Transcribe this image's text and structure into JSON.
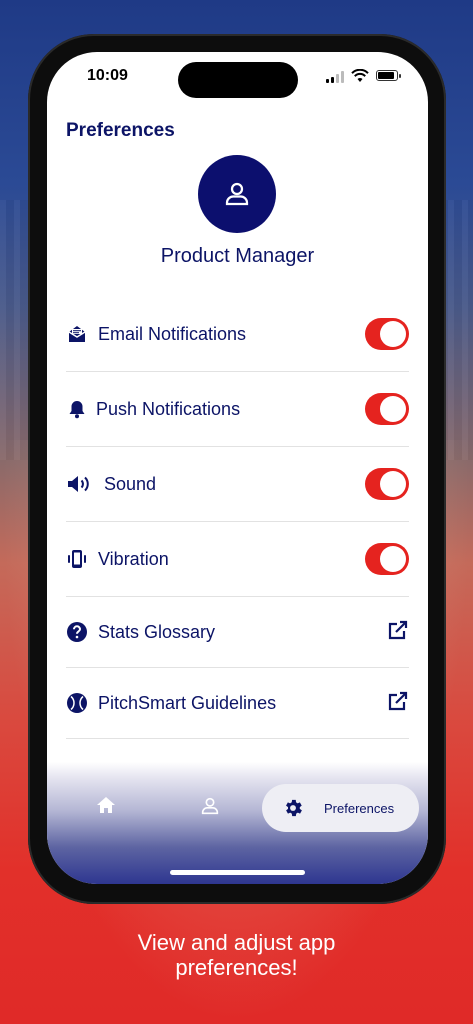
{
  "status_bar": {
    "time": "10:09"
  },
  "header": {
    "title": "Preferences"
  },
  "profile": {
    "name": "Product Manager",
    "avatar_icon": "user-icon",
    "avatar_color": "#0c0f6e"
  },
  "settings": {
    "toggles": [
      {
        "label": "Email Notifications",
        "icon": "envelope-icon",
        "enabled": true
      },
      {
        "label": "Push Notifications",
        "icon": "bell-icon",
        "enabled": true
      },
      {
        "label": "Sound",
        "icon": "speaker-icon",
        "enabled": true
      },
      {
        "label": "Vibration",
        "icon": "phone-vibrate-icon",
        "enabled": true
      }
    ],
    "links": [
      {
        "label": "Stats Glossary",
        "icon": "question-circle-icon",
        "action_icon": "external-link-icon"
      },
      {
        "label": "PitchSmart Guidelines",
        "icon": "baseball-icon",
        "action_icon": "external-link-icon"
      }
    ],
    "toggle_on_color": "#e5231f"
  },
  "tab_bar": {
    "tabs": [
      {
        "icon": "home-icon",
        "label": ""
      },
      {
        "icon": "user-icon",
        "label": ""
      },
      {
        "icon": "gear-icon",
        "label": "Preferences",
        "active": true
      }
    ]
  },
  "caption": {
    "line1": "View and adjust app",
    "line2": "preferences!"
  },
  "colors": {
    "primary": "#0c1466",
    "accent": "#e5231f"
  }
}
